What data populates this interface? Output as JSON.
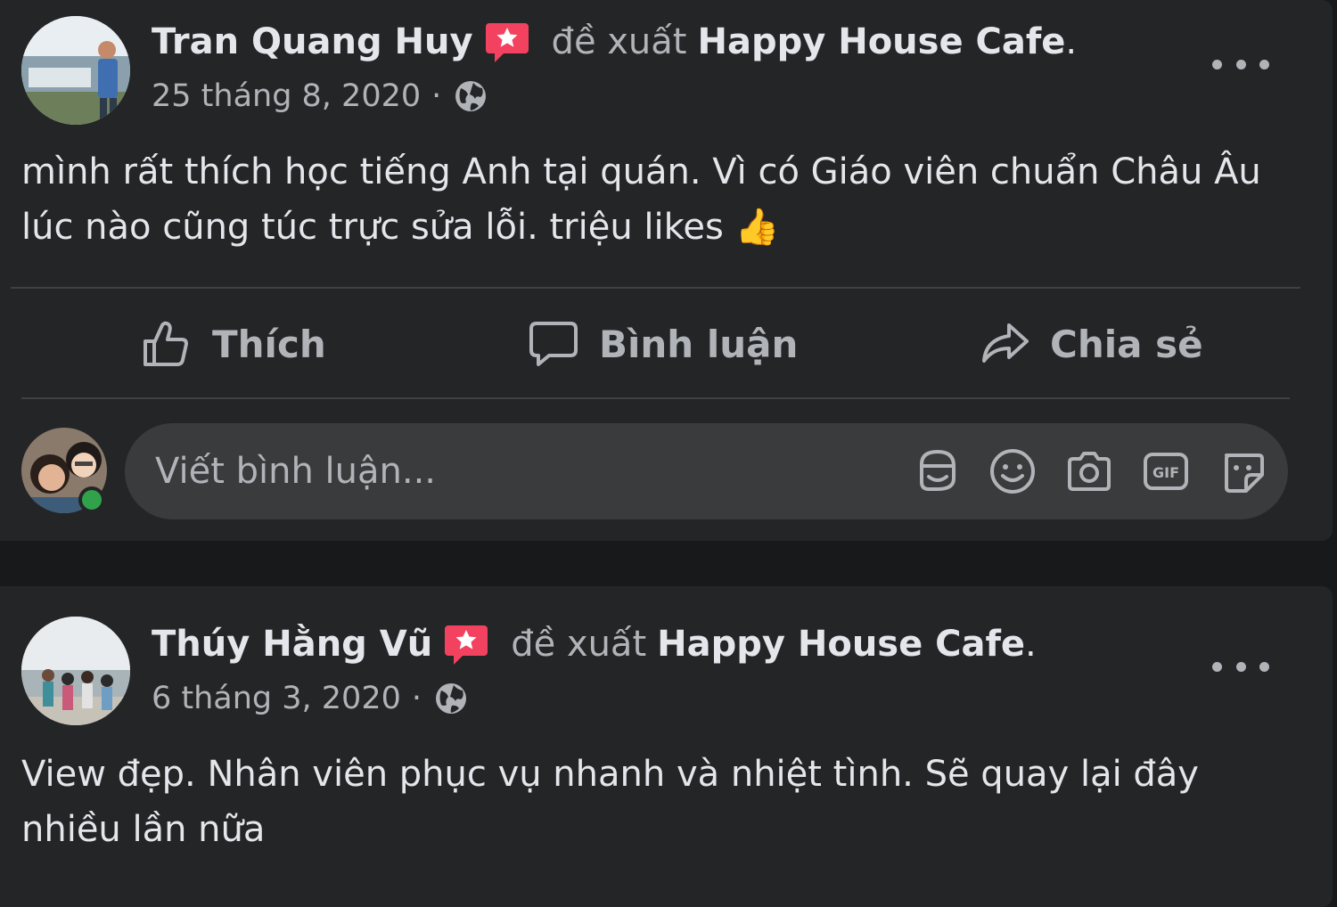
{
  "posts": [
    {
      "author": "Tran Quang Huy",
      "verb": "đề xuất",
      "page": "Happy House Cafe",
      "date": "25 tháng 8, 2020",
      "separator": "·",
      "text": "mình rất thích học tiếng Anh tại quán. Vì có Giáo viên chuẩn Châu Âu lúc nào cũng túc trực sửa lỗi. triệu likes 👍"
    },
    {
      "author": "Thúy Hằng Vũ",
      "verb": "đề xuất",
      "page": "Happy House Cafe",
      "date": "6 tháng 3, 2020",
      "separator": "·",
      "text": "View đẹp. Nhân viên phục vụ nhanh và nhiệt tình. Sẽ quay lại đây nhiều lần nữa"
    }
  ],
  "actions": {
    "like": "Thích",
    "comment": "Bình luận",
    "share": "Chia sẻ"
  },
  "comment_box": {
    "placeholder": "Viết bình luận..."
  },
  "icons": {
    "recommend": "recommend-icon",
    "privacy": "globe-icon",
    "more": "more-options-icon",
    "like": "thumbs-up-icon",
    "comment": "speech-bubble-icon",
    "share": "share-arrow-icon",
    "avatar_sticker": "avatar-sticker-icon",
    "emoji": "emoji-icon",
    "camera": "camera-icon",
    "gif": "gif-icon",
    "sticker": "sticker-icon"
  },
  "colors": {
    "background": "#18191a",
    "card": "#242526",
    "input": "#3a3b3c",
    "primary_text": "#e4e6eb",
    "secondary_text": "#b0b3b8",
    "recommend_red": "#f3425f",
    "online_green": "#31a24c"
  }
}
